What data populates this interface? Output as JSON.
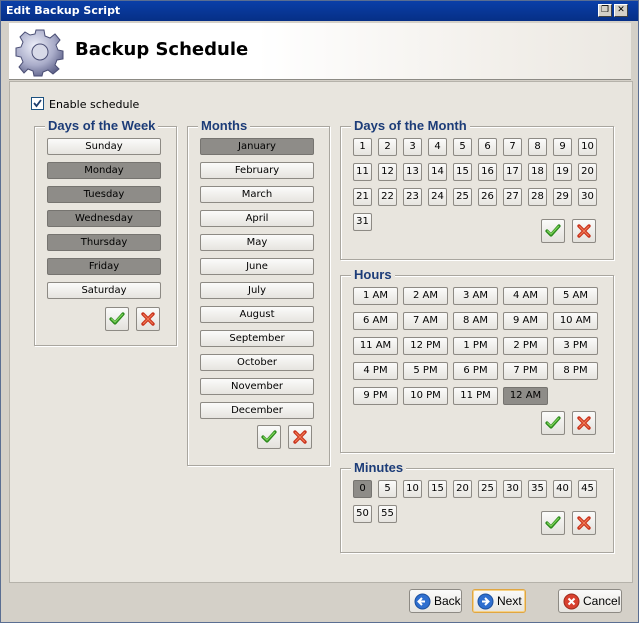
{
  "window": {
    "title": "Edit Backup Script",
    "restore_icon": "restore-icon",
    "close_icon": "close-icon"
  },
  "header": {
    "title": "Backup Schedule",
    "icon": "gear-icon"
  },
  "enable_schedule": {
    "label": "Enable schedule",
    "checked": true
  },
  "days_of_week": {
    "title": "Days of the Week",
    "items": [
      {
        "label": "Sunday",
        "selected": false
      },
      {
        "label": "Monday",
        "selected": true
      },
      {
        "label": "Tuesday",
        "selected": true
      },
      {
        "label": "Wednesday",
        "selected": true
      },
      {
        "label": "Thursday",
        "selected": true
      },
      {
        "label": "Friday",
        "selected": true
      },
      {
        "label": "Saturday",
        "selected": false
      }
    ]
  },
  "months": {
    "title": "Months",
    "items": [
      {
        "label": "January",
        "selected": true
      },
      {
        "label": "February",
        "selected": false
      },
      {
        "label": "March",
        "selected": false
      },
      {
        "label": "April",
        "selected": false
      },
      {
        "label": "May",
        "selected": false
      },
      {
        "label": "June",
        "selected": false
      },
      {
        "label": "July",
        "selected": false
      },
      {
        "label": "August",
        "selected": false
      },
      {
        "label": "September",
        "selected": false
      },
      {
        "label": "October",
        "selected": false
      },
      {
        "label": "November",
        "selected": false
      },
      {
        "label": "December",
        "selected": false
      }
    ]
  },
  "days_of_month": {
    "title": "Days of the Month",
    "items": [
      "1",
      "2",
      "3",
      "4",
      "5",
      "6",
      "7",
      "8",
      "9",
      "10",
      "11",
      "12",
      "13",
      "14",
      "15",
      "16",
      "17",
      "18",
      "19",
      "20",
      "21",
      "22",
      "23",
      "24",
      "25",
      "26",
      "27",
      "28",
      "29",
      "30",
      "31"
    ],
    "selected": []
  },
  "hours": {
    "title": "Hours",
    "items": [
      "1 AM",
      "2 AM",
      "3 AM",
      "4 AM",
      "5 AM",
      "6 AM",
      "7 AM",
      "8 AM",
      "9 AM",
      "10 AM",
      "11 AM",
      "12 PM",
      "1 PM",
      "2 PM",
      "3 PM",
      "4 PM",
      "5 PM",
      "6 PM",
      "7 PM",
      "8 PM",
      "9 PM",
      "10 PM",
      "11 PM",
      "12 AM"
    ],
    "selected": [
      "12 AM"
    ]
  },
  "minutes": {
    "title": "Minutes",
    "items": [
      "0",
      "5",
      "10",
      "15",
      "20",
      "25",
      "30",
      "35",
      "40",
      "45",
      "50",
      "55"
    ],
    "selected": [
      "0"
    ]
  },
  "icons": {
    "select_all": "checkmark-icon",
    "clear": "red-x-icon"
  },
  "footer": {
    "back": {
      "label": "Back",
      "icon": "back-arrow-icon"
    },
    "next": {
      "label": "Next",
      "icon": "next-arrow-icon"
    },
    "cancel": {
      "label": "Cancel",
      "icon": "cancel-icon"
    }
  },
  "colors": {
    "group_title": "#1c3c78",
    "selected_button": "#8e8c88",
    "title_bar": "#0a3fa8"
  }
}
